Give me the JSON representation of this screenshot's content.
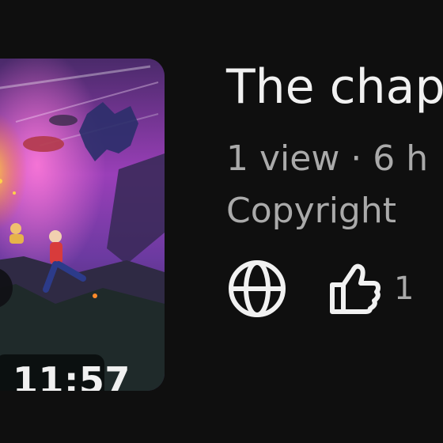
{
  "video": {
    "title": "The chap",
    "duration": "11:57",
    "meta": "1 view · 6 h",
    "copyright": "Copyright"
  },
  "stats": {
    "like_count": "1"
  },
  "icons": {
    "visibility": "globe-icon",
    "like": "thumbs-up-icon",
    "duration_badge_prefix": "partial-glyph"
  },
  "colors": {
    "background": "#0f0f0f",
    "primary_text": "#f1f1f1",
    "secondary_text": "#aaaaaa"
  }
}
